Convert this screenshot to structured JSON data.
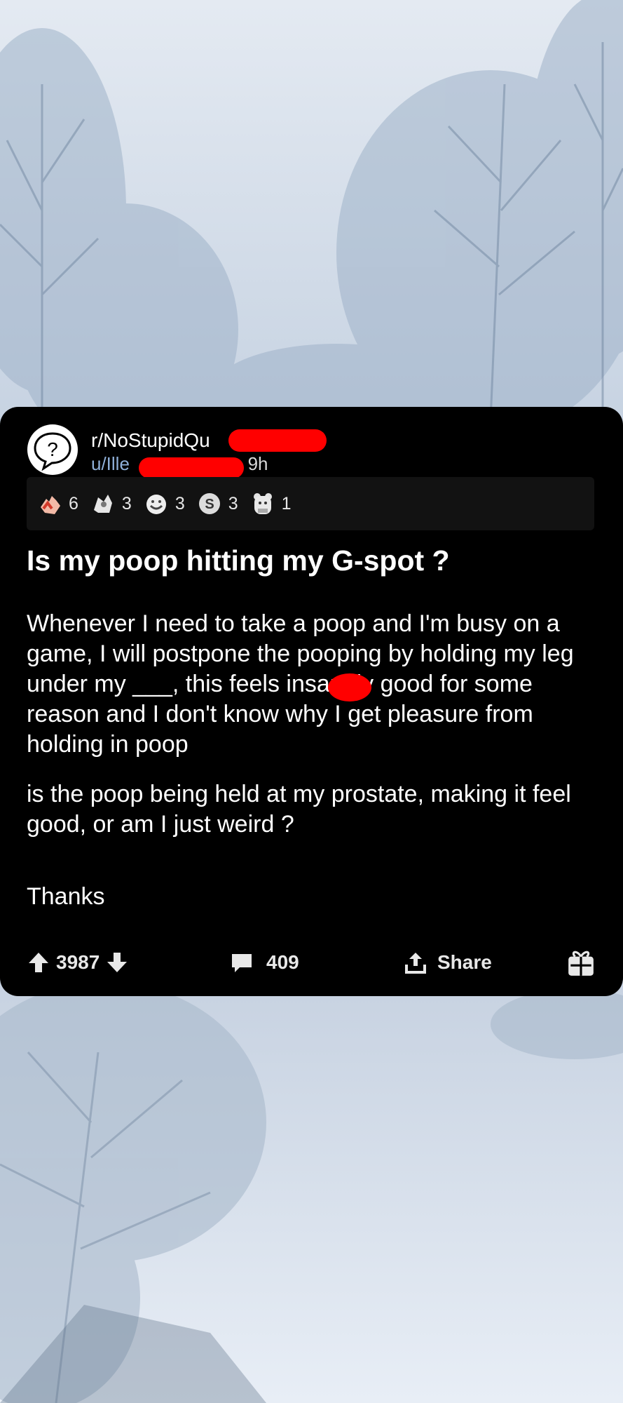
{
  "post": {
    "subreddit": "r/NoStupidQu",
    "user": "u/Ille",
    "time": "9h",
    "title": "Is my poop hitting my G-spot ?",
    "body": [
      "Whenever I need to take a poop and I'm busy on a game, I will postpone the pooping by holding my leg under my ___, this feels insanely good for some reason and I don't know why I get pleasure from holding in poop",
      "is the poop being held at my prostate, making it feel good, or am I just weird ?",
      "Thanks"
    ],
    "awards": [
      {
        "icon": "hand-award-icon",
        "count": "6"
      },
      {
        "icon": "helpful-award-icon",
        "count": "3"
      },
      {
        "icon": "wholesome-award-icon",
        "count": "3"
      },
      {
        "icon": "silver-award-icon",
        "count": "3"
      },
      {
        "icon": "bear-award-icon",
        "count": "1"
      }
    ],
    "score": "3987",
    "comments": "409",
    "share_label": "Share"
  },
  "colors": {
    "card": "#000000",
    "username": "#8fb0d9",
    "redaction": "#ff0000"
  }
}
